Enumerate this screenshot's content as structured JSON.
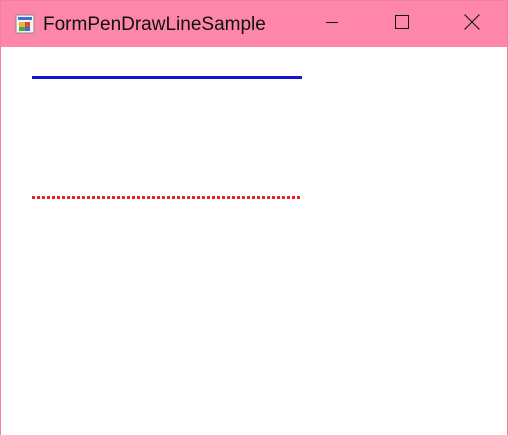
{
  "window": {
    "title": "FormPenDrawLineSample",
    "titlebar_color": "#fe86ab",
    "controls": {
      "minimize_icon": "minimize-icon",
      "maximize_icon": "maximize-icon",
      "close_icon": "close-icon"
    }
  },
  "canvas": {
    "lines": [
      {
        "style": "solid",
        "color": "#1313d0"
      },
      {
        "style": "dotted",
        "color": "#e8202a"
      }
    ]
  }
}
